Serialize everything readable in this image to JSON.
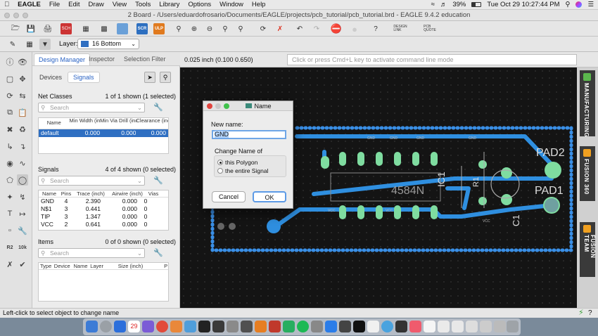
{
  "menubar": {
    "app": "EAGLE",
    "items": [
      "File",
      "Edit",
      "Draw",
      "View",
      "Tools",
      "Library",
      "Options",
      "Window",
      "Help"
    ],
    "battery": "39%",
    "datetime": "Tue Oct 29  10:27:44 PM"
  },
  "window": {
    "title": "2 Board - /Users/eduardofrosario/Documents/EAGLE/projects/pcb_tutorial/pcb_tutorial.brd - EAGLE 9.4.2 education"
  },
  "toolbar": {
    "layer_label": "Layer:",
    "layer_value": "16 Bottom",
    "design_link": "DESIGN\nLINK",
    "pcb_quote": "PCB\nQUOTE",
    "scr": "SCR",
    "ulp": "ULP"
  },
  "panel": {
    "tabs": [
      "Design Manager",
      "Inspector",
      "Selection Filter"
    ],
    "subtabs": [
      "Devices",
      "Signals"
    ],
    "net_classes": {
      "title": "Net Classes",
      "count": "1 of 1 shown (1 selected)",
      "search_placeholder": "Search",
      "headers": [
        "Name",
        "Min Width (inch)",
        "Min Via Drill (inch)",
        "Clearance (inch)"
      ],
      "rows": [
        [
          "default",
          "0.000",
          "0.000",
          "0.000"
        ]
      ]
    },
    "signals": {
      "title": "Signals",
      "count": "4 of 4 shown (0 selected)",
      "search_placeholder": "Search",
      "headers": [
        "Name",
        "Pins",
        "Trace (inch)",
        "Airwire (inch)",
        "Vias"
      ],
      "rows": [
        [
          "GND",
          "4",
          "2.390",
          "0.000",
          "0"
        ],
        [
          "N$1",
          "3",
          "0.441",
          "0.000",
          "0"
        ],
        [
          "TIP",
          "3",
          "1.347",
          "0.000",
          "0"
        ],
        [
          "VCC",
          "2",
          "0.641",
          "0.000",
          "0"
        ]
      ]
    },
    "items": {
      "title": "Items",
      "count": "0 of 0 shown (0 selected)",
      "search_placeholder": "Search",
      "headers": [
        "Type",
        "Device",
        "Name",
        "Layer",
        "Size (inch)",
        "P"
      ]
    }
  },
  "coords": "0.025 inch (0.100 0.650)",
  "command_placeholder": "Click or press Cmd+L key to activate command line mode",
  "board": {
    "labels": [
      "PAD2",
      "PAD1",
      "4584N",
      "IC1",
      "R1",
      "C1",
      "GND",
      "GND",
      "GND",
      "GND",
      "VCC",
      "VCC",
      "VCC"
    ]
  },
  "right_tabs": [
    "MANUFACTURING",
    "FUSION 360",
    "FUSION TEAM"
  ],
  "dialog": {
    "title": "Name",
    "new_name_label": "New name:",
    "new_name_value": "GND",
    "change_label": "Change Name of",
    "option_polygon": "this Polygon",
    "option_signal": "the entire Signal",
    "cancel": "Cancel",
    "ok": "OK"
  },
  "status": "Left-click to select object to change name",
  "dock": {
    "calendar_day": "29"
  },
  "colors": {
    "selection": "#2f6fc2",
    "trace_bottom": "#2f8fe0",
    "pad_green": "#7fdca0",
    "canvas": "#141414"
  }
}
